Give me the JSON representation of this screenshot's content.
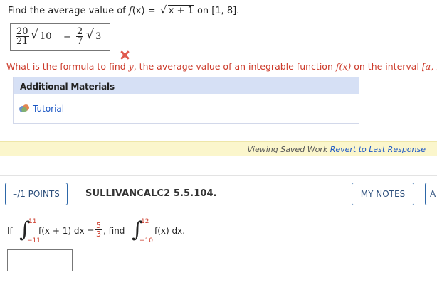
{
  "question1": {
    "prompt_lead": "Find the average value of ",
    "prompt_fn": "f",
    "prompt_x": "(x) = ",
    "prompt_radicand": "x + 1",
    "prompt_interval_pre": " on ",
    "prompt_interval": "[1, 8]",
    "prompt_end": ".",
    "answer": {
      "frac1_num": "20",
      "frac1_den": "21",
      "root1": "10",
      "minus": "−",
      "frac2_num": "2",
      "frac2_den": "7",
      "root2": "3"
    },
    "hint_pre": "What is the formula to find ",
    "hint_var": "y",
    "hint_mid": ", the average value of an integrable function ",
    "hint_fn": "f(x)",
    "hint_mid2": " on the interval ",
    "hint_interval": "[a, b]",
    "hint_end": "?"
  },
  "materials": {
    "header": "Additional Materials",
    "tutorial_label": "Tutorial"
  },
  "saved_bar": {
    "viewing": "Viewing Saved Work",
    "revert": "Revert to Last Response"
  },
  "question2": {
    "points_label": "–/1 POINTS",
    "id": "SULLIVANCALC2 5.5.104.",
    "mynotes_label": "MY NOTES",
    "ask_label": "A",
    "if": "If",
    "upper1": "11",
    "lower1": "−11",
    "integrand1": "f(x + 1) dx = ",
    "frac_num": "5",
    "frac_den": "3",
    "find": ", find",
    "upper2": "12",
    "lower2": "−10",
    "integrand2": "f(x) dx."
  },
  "colors": {
    "link": "#1a56c4",
    "hint_red": "#cc3a2a",
    "button_border": "#2d67a8",
    "saved_bar_bg": "#fbf6cc",
    "materials_header_bg": "#d6e0f5"
  }
}
